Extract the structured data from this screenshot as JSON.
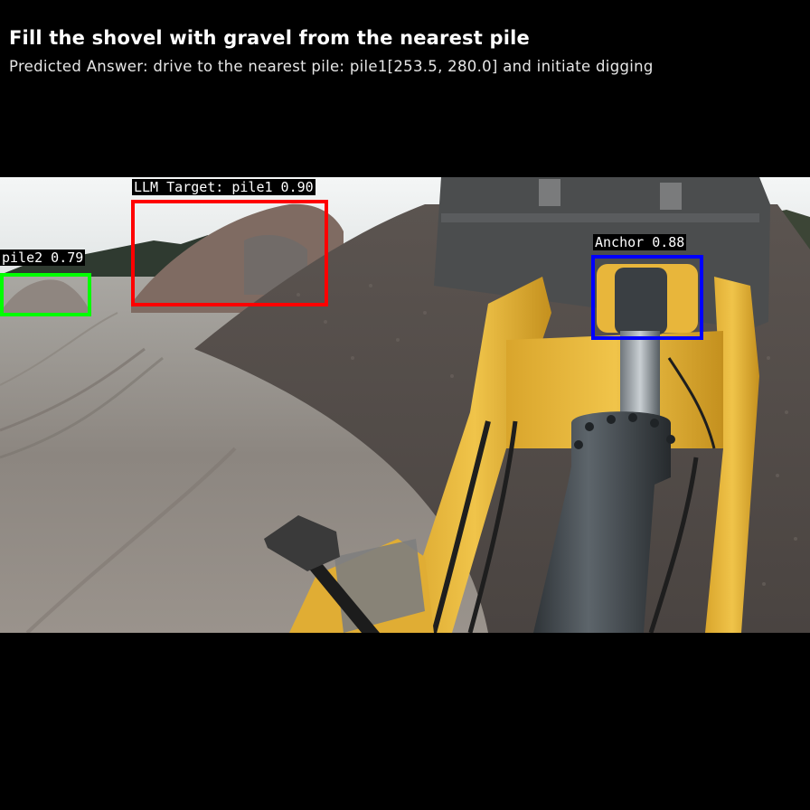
{
  "task": {
    "title": "Fill the shovel with gravel from the nearest pile",
    "predicted_answer": "Predicted Answer: drive to the nearest pile: pile1[253.5, 280.0] and initiate digging"
  },
  "detections": [
    {
      "id": "llm-target",
      "label": "LLM Target: pile1 0.90",
      "color": "#ff0000"
    },
    {
      "id": "pile2",
      "label": "pile2 0.79",
      "color": "#00ff00"
    },
    {
      "id": "anchor",
      "label": "Anchor 0.88",
      "color": "#0000ff"
    }
  ],
  "scene": {
    "description_icons": [
      "gravel-pile",
      "wheel-loader-arm",
      "hydraulic-cylinder",
      "control-lever"
    ]
  }
}
